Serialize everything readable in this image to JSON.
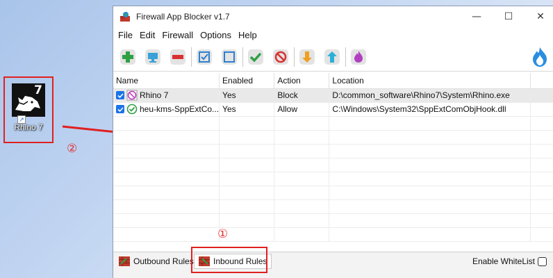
{
  "desktop": {
    "icon_label": "Rhino 7",
    "icon_badge": "7",
    "marker_1": "①",
    "marker_2": "②"
  },
  "window": {
    "title": "Firewall App Blocker v1.7",
    "controls": {
      "minimize": "—",
      "maximize": "☐",
      "close": "✕"
    }
  },
  "menu": [
    "File",
    "Edit",
    "Firewall",
    "Options",
    "Help"
  ],
  "toolbar": {
    "buttons": [
      "add-icon",
      "monitor-icon",
      "remove-icon",
      "check-box-icon",
      "uncheck-box-icon",
      "allow-icon",
      "block-icon",
      "down-arrow-icon",
      "up-arrow-icon",
      "flame-icon"
    ]
  },
  "table": {
    "columns": [
      "Name",
      "Enabled",
      "Action",
      "Location"
    ],
    "rows": [
      {
        "name": "Rhino 7",
        "enabled": "Yes",
        "action": "Block",
        "location": "D:\\common_software\\Rhino7\\System\\Rhino.exe"
      },
      {
        "name": "heu-kms-SppExtCo...",
        "enabled": "Yes",
        "action": "Allow",
        "location": "C:\\Windows\\System32\\SppExtComObjHook.dll"
      }
    ]
  },
  "bottom": {
    "tab_outbound": "Outbound Rules",
    "tab_inbound": "Inbound Rules",
    "whitelist_label": "Enable WhiteList"
  },
  "colors": {
    "accent": "#1a73e8",
    "highlight": "#e02020",
    "selected_row": "#e9e9e9"
  }
}
